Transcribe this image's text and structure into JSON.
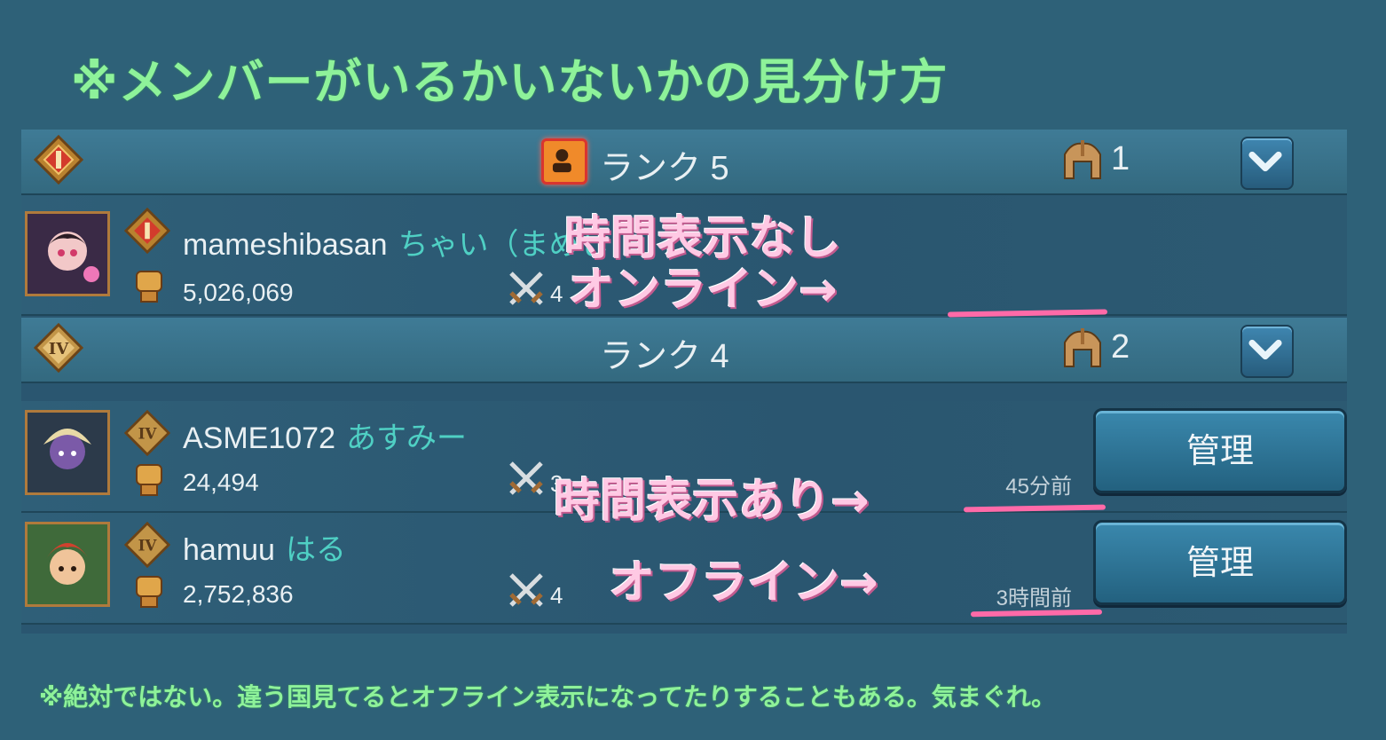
{
  "title": "※メンバーがいるかいないかの見分け方",
  "rank5": {
    "label": "ランク 5",
    "count": "1",
    "icon": "person-online-icon"
  },
  "rank4": {
    "label": "ランク 4",
    "count": "2"
  },
  "members": [
    {
      "name": "mameshibasan",
      "nick": "ちゃい（まめし",
      "power": "5,026,069",
      "kills": "4",
      "last_seen": ""
    },
    {
      "name": "ASME1072",
      "nick": "あすみー",
      "power": "24,494",
      "kills": "3",
      "last_seen": "45分前",
      "manage": "管理"
    },
    {
      "name": "hamuu",
      "nick": "はる",
      "power": "2,752,836",
      "kills": "4",
      "last_seen": "3時間前",
      "manage": "管理"
    }
  ],
  "notes": {
    "no_time_line1": "時間表示なし",
    "no_time_line2": "オンライン→",
    "with_time": "時間表示あり→",
    "offline": "オフライン→"
  },
  "footer": "※絶対ではない。違う国見てるとオフライン表示になってたりすることもある。気まぐれ。",
  "colors": {
    "title": "#8ef29a",
    "note": "#ffc9e4",
    "underline": "#ff6aa8",
    "background": "#2e6178"
  }
}
